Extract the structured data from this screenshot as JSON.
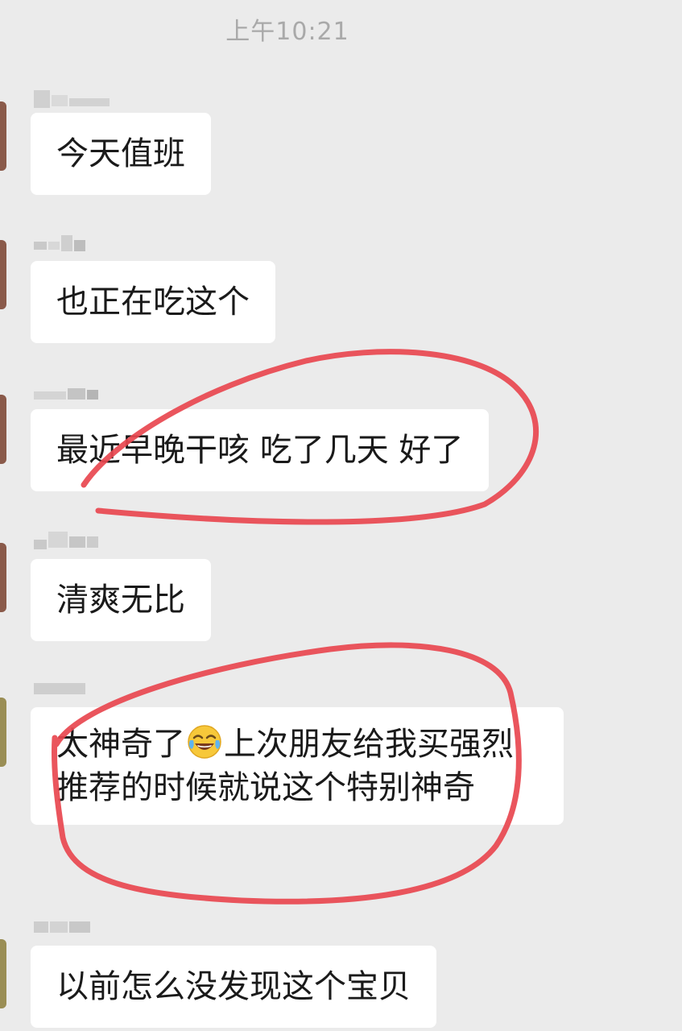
{
  "chat": {
    "timestamp": "上午10:21",
    "messages": [
      {
        "text": "今天值班"
      },
      {
        "text": "也正在吃这个"
      },
      {
        "text": "最近早晚干咳 吃了几天 好了"
      },
      {
        "text": "清爽无比"
      },
      {
        "text_before_emoji": "太神奇了",
        "emoji": "face-with-tears-of-joy",
        "text_after_emoji": "上次朋友给我买强烈推荐的时候就说这个特别神奇"
      },
      {
        "text": "以前怎么没发现这个宝贝"
      }
    ]
  },
  "colors": {
    "background": "#ebebeb",
    "bubble": "#ffffff",
    "text": "#1a1a1a",
    "timestamp": "#a9a9a9",
    "annotation": "#e8474f"
  },
  "icons": {
    "emoji": "face-with-tears-of-joy-icon"
  }
}
